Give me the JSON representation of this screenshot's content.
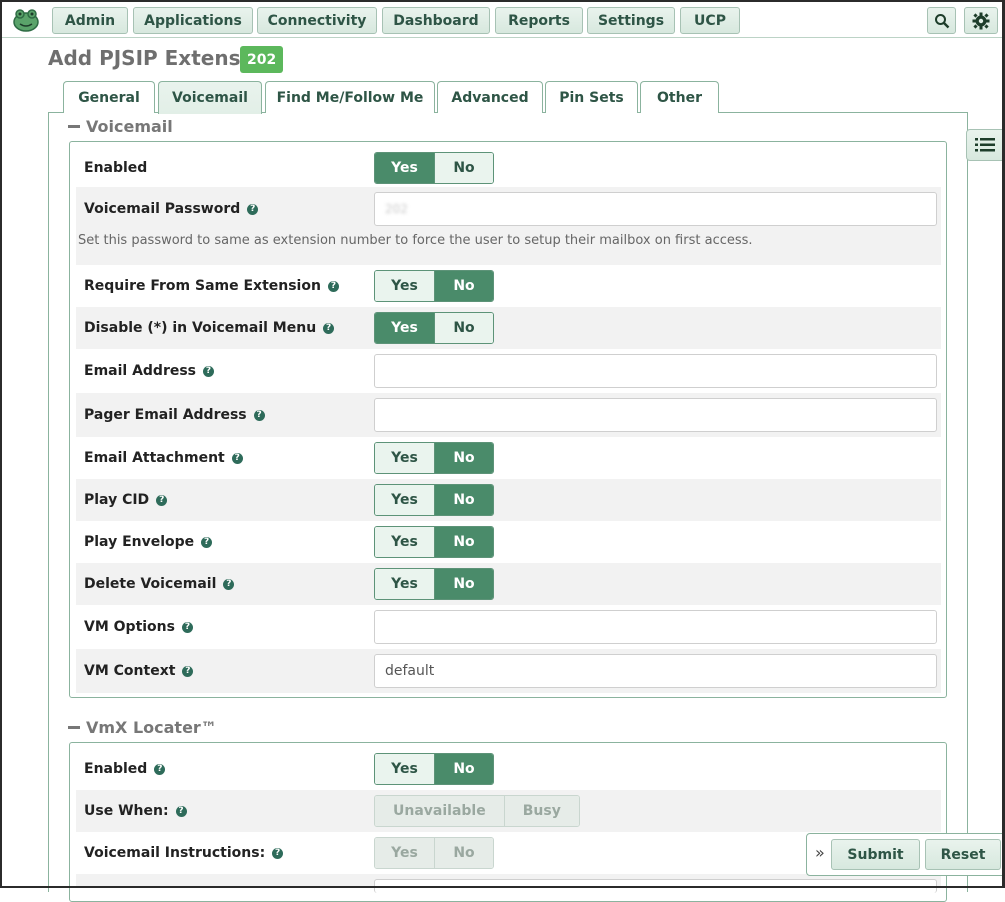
{
  "nav": {
    "items": [
      {
        "label": "Admin"
      },
      {
        "label": "Applications"
      },
      {
        "label": "Connectivity"
      },
      {
        "label": "Dashboard"
      },
      {
        "label": "Reports"
      },
      {
        "label": "Settings"
      },
      {
        "label": "UCP"
      }
    ],
    "search_icon": "search-icon",
    "settings_icon": "gear-icon"
  },
  "page": {
    "title": "Add PJSIP Extension",
    "badge": "202"
  },
  "tabs": [
    {
      "label": "General"
    },
    {
      "label": "Voicemail",
      "active": true
    },
    {
      "label": "Find Me/Follow Me"
    },
    {
      "label": "Advanced"
    },
    {
      "label": "Pin Sets"
    },
    {
      "label": "Other"
    }
  ],
  "voicemail": {
    "heading": "Voicemail",
    "enabled": {
      "label": "Enabled",
      "yes": "Yes",
      "no": "No",
      "value": "Yes"
    },
    "password": {
      "label": "Voicemail Password",
      "value": "202",
      "help_text": "Set this password to same as extension number to force the user to setup their mailbox on first access."
    },
    "require_same_ext": {
      "label": "Require From Same Extension",
      "yes": "Yes",
      "no": "No",
      "value": "No"
    },
    "disable_star": {
      "label": "Disable (*) in Voicemail Menu",
      "yes": "Yes",
      "no": "No",
      "value": "Yes"
    },
    "email": {
      "label": "Email Address",
      "value": ""
    },
    "pager_email": {
      "label": "Pager Email Address",
      "value": ""
    },
    "email_attachment": {
      "label": "Email Attachment",
      "yes": "Yes",
      "no": "No",
      "value": "No"
    },
    "play_cid": {
      "label": "Play CID",
      "yes": "Yes",
      "no": "No",
      "value": "No"
    },
    "play_envelope": {
      "label": "Play Envelope",
      "yes": "Yes",
      "no": "No",
      "value": "No"
    },
    "delete_vm": {
      "label": "Delete Voicemail",
      "yes": "Yes",
      "no": "No",
      "value": "No"
    },
    "vm_options": {
      "label": "VM Options",
      "value": ""
    },
    "vm_context": {
      "label": "VM Context",
      "value": "default"
    }
  },
  "vmx": {
    "heading": "VmX Locater™",
    "enabled": {
      "label": "Enabled",
      "yes": "Yes",
      "no": "No",
      "value": "No"
    },
    "use_when": {
      "label": "Use When:",
      "opt1": "Unavailable",
      "opt2": "Busy"
    },
    "instructions": {
      "label": "Voicemail Instructions:",
      "yes": "Yes",
      "no": "No"
    }
  },
  "actions": {
    "expand": "»",
    "submit": "Submit",
    "reset": "Reset"
  },
  "colors": {
    "accent": "#4a8b6a",
    "badge": "#5cb85c",
    "border": "#8bb39e"
  }
}
